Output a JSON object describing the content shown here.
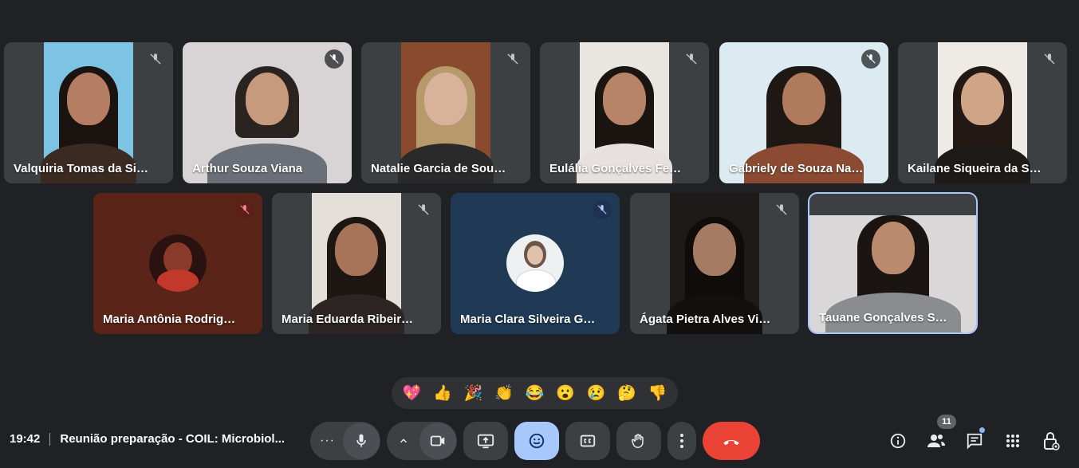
{
  "participants": [
    {
      "name": "Valquiria Tomas da Silva"
    },
    {
      "name": "Arthur Souza Viana"
    },
    {
      "name": "Natalie Garcia de Souza"
    },
    {
      "name": "Eulália Gonçalves Ferr..."
    },
    {
      "name": "Gabriely de Souza Nas..."
    },
    {
      "name": "Kailane Siqueira da Silva"
    },
    {
      "name": "Maria Antônia Rodrigu..."
    },
    {
      "name": "Maria Eduarda Ribeiro..."
    },
    {
      "name": "Maria Clara Silveira Go..."
    },
    {
      "name": "Ágata Pietra Alves Viei..."
    },
    {
      "name": "Tauane Gonçalves So..."
    }
  ],
  "reactions": [
    "💖",
    "👍",
    "🎉",
    "👏",
    "😂",
    "😮",
    "😢",
    "🤔",
    "👎"
  ],
  "meeting": {
    "time": "19:42",
    "title": "Reunião preparação - COIL: Microbiol..."
  },
  "people_count": "11",
  "colors": {
    "background": "#202124",
    "tile": "#3c4043",
    "end_call": "#ea4335",
    "active_control": "#a8c7fa",
    "active_border": "#a8c7fa"
  },
  "icons": {
    "more": "more-options-icon",
    "mic": "microphone-icon",
    "camera": "camera-icon",
    "present": "present-screen-icon",
    "emoji": "emoji-icon",
    "captions": "captions-icon",
    "hand": "raise-hand-icon",
    "end": "end-call-icon",
    "info": "info-icon",
    "people": "people-icon",
    "chat": "chat-icon",
    "activities": "apps-grid-icon",
    "host": "host-controls-icon"
  }
}
